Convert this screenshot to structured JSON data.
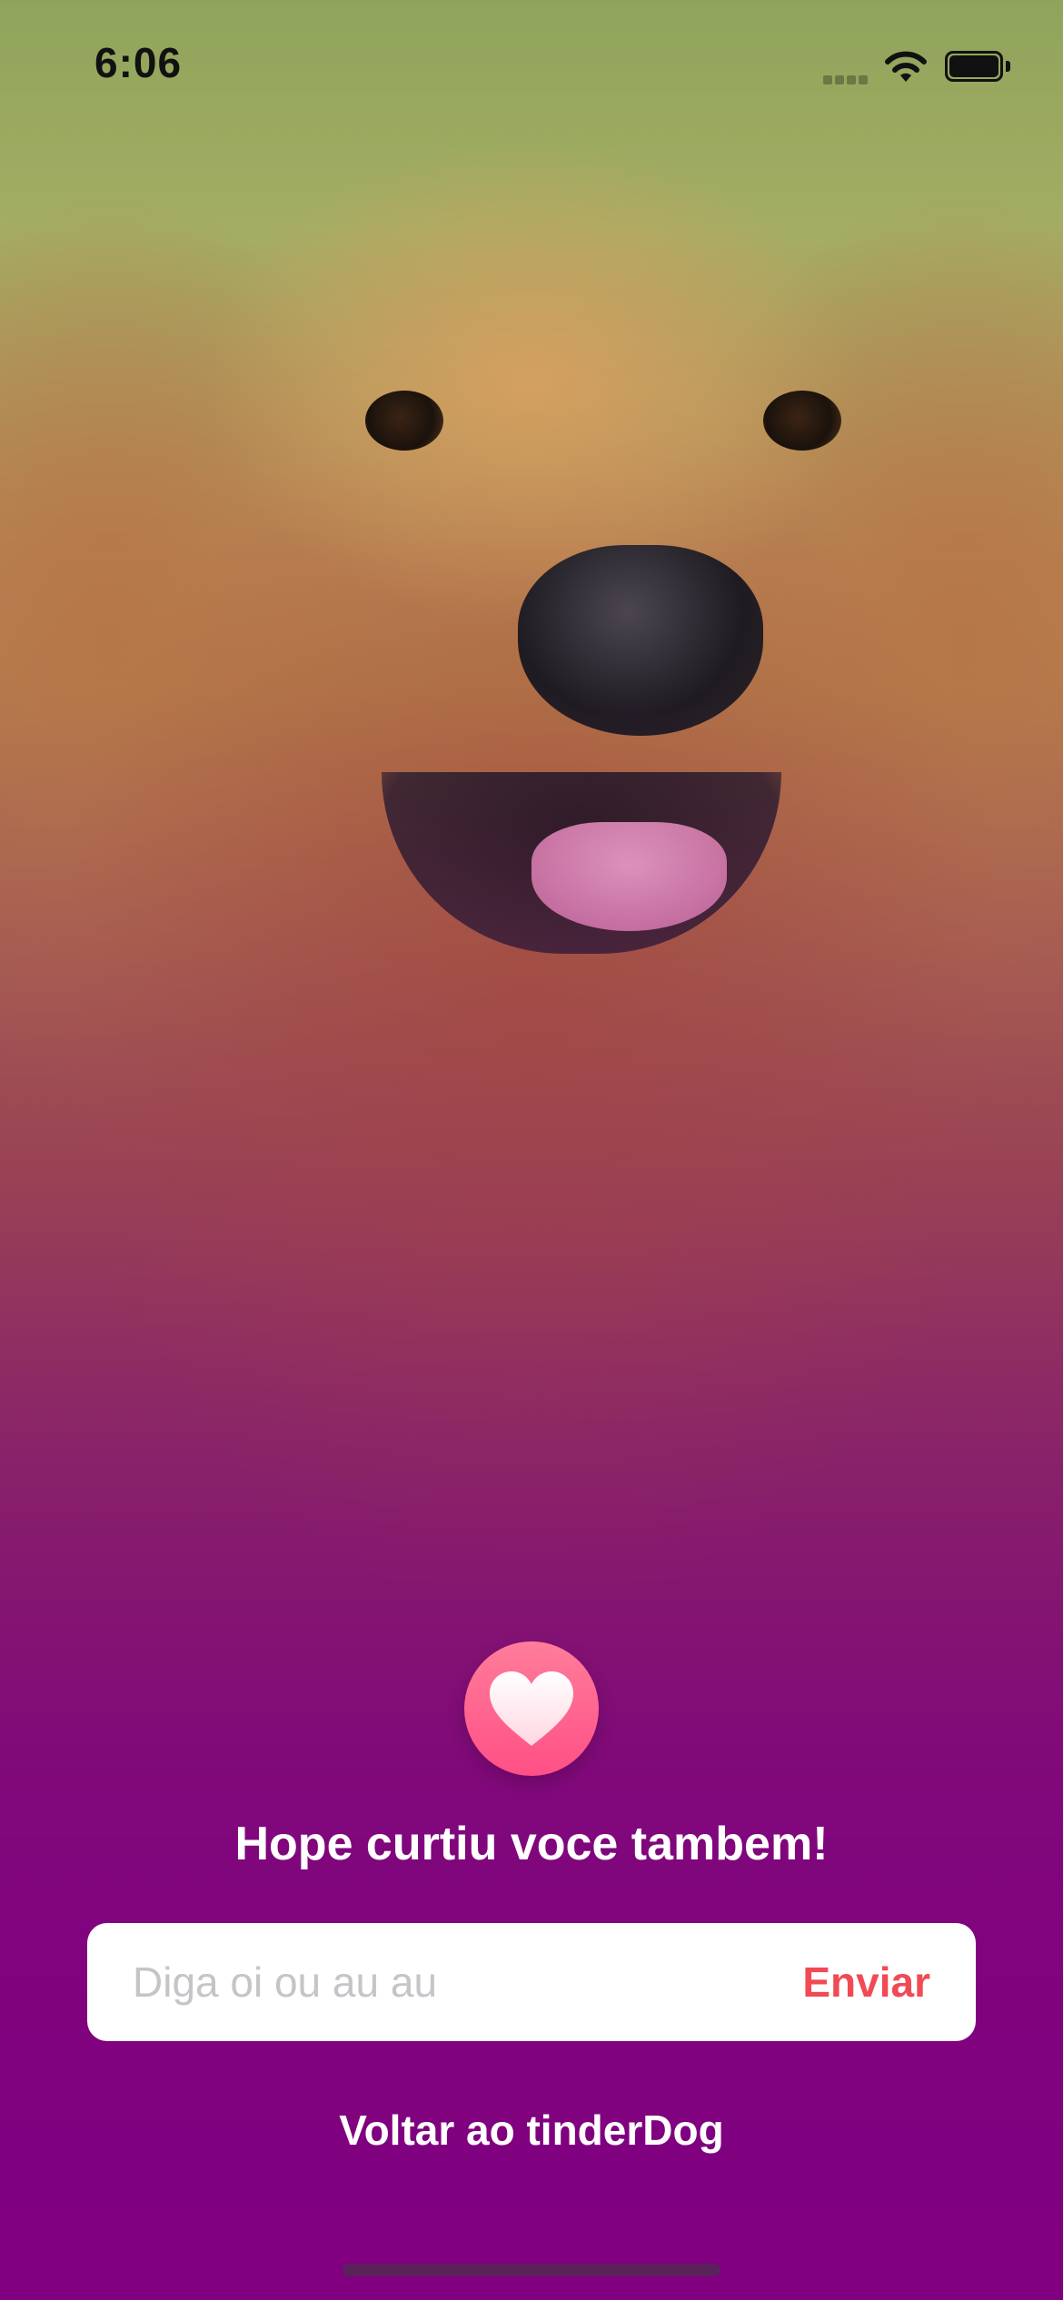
{
  "status_bar": {
    "time": "6:06"
  },
  "match": {
    "icon": "heart-icon",
    "title": "Hope curtiu voce tambem!",
    "accent_color": "#ff4f86"
  },
  "message": {
    "placeholder": "Diga oi ou au au",
    "value": "",
    "send_label": "Enviar",
    "send_color": "#f04a55"
  },
  "navigation": {
    "back_label": "Voltar ao tinderDog"
  },
  "theme": {
    "overlay_color": "#800080"
  }
}
